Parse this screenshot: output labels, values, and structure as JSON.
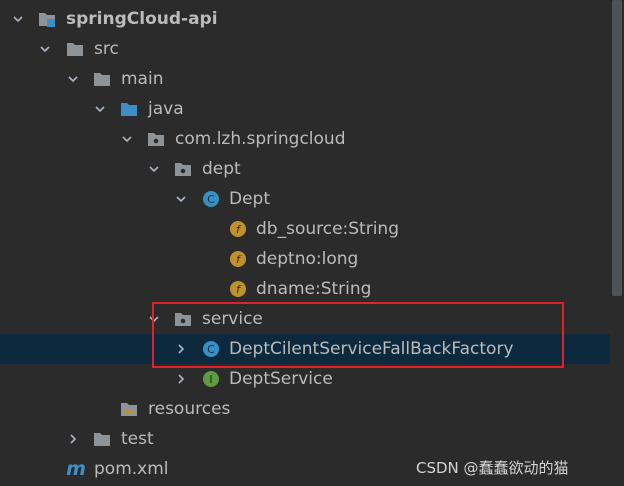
{
  "project_tree": {
    "items": [
      {
        "label": "springCloud-api",
        "icon": "module-folder-icon"
      },
      {
        "label": "src",
        "icon": "folder-icon"
      },
      {
        "label": "main",
        "icon": "folder-icon"
      },
      {
        "label": "java",
        "icon": "source-root-folder-icon"
      },
      {
        "label": "com.lzh.springcloud",
        "icon": "package-icon"
      },
      {
        "label": "dept",
        "icon": "package-icon"
      },
      {
        "label": "Dept",
        "icon": "class-icon",
        "badge": "C"
      },
      {
        "label": "db_source:String",
        "icon": "field-icon",
        "badge": "f"
      },
      {
        "label": "deptno:long",
        "icon": "field-icon",
        "badge": "f"
      },
      {
        "label": "dname:String",
        "icon": "field-icon",
        "badge": "f"
      },
      {
        "label": "service",
        "icon": "package-icon"
      },
      {
        "label": "DeptCilentServiceFallBackFactory",
        "icon": "class-icon",
        "badge": "C"
      },
      {
        "label": "DeptService",
        "icon": "interface-icon",
        "badge": "I"
      },
      {
        "label": "resources",
        "icon": "resources-folder-icon"
      },
      {
        "label": "test",
        "icon": "folder-icon"
      },
      {
        "label": "pom.xml",
        "icon": "maven-icon",
        "badge": "m"
      }
    ]
  },
  "watermark": "CSDN @蠢蠢欲动的猫",
  "colors": {
    "background": "#2b2b2b",
    "selection": "#0d293e",
    "highlight_box": "#e0232a",
    "class_icon": "#3592c4",
    "field_icon": "#c0922f",
    "interface_icon": "#5d9c42",
    "folder": "#8c9399",
    "source_folder": "#3d8fc6"
  }
}
